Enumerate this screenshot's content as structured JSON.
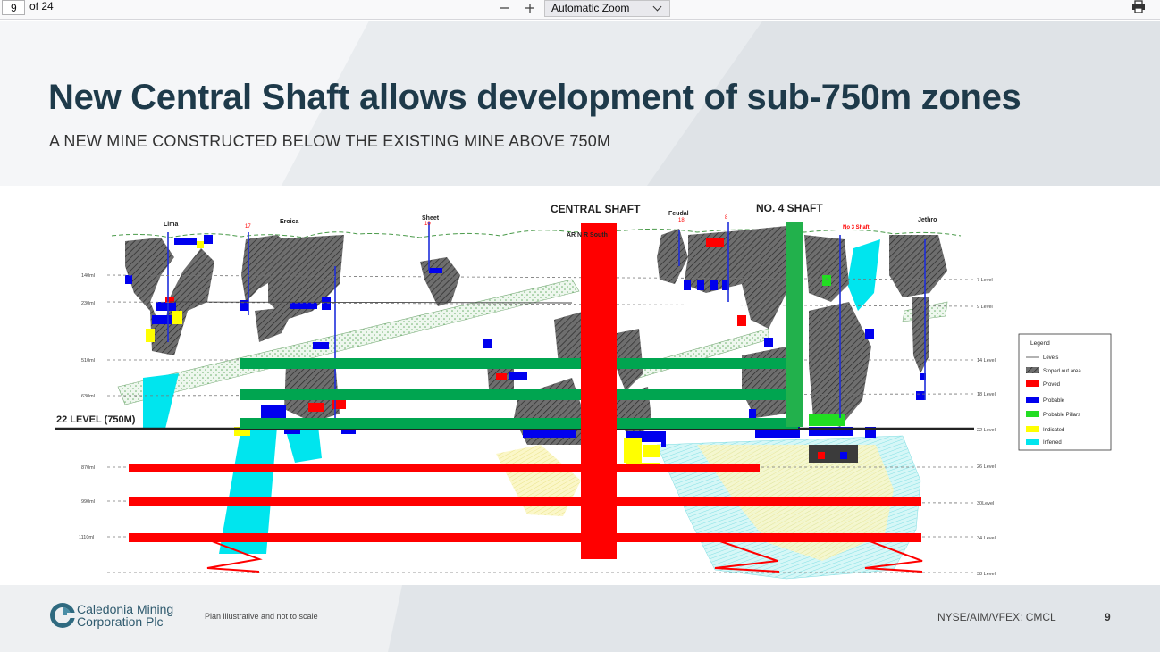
{
  "toolbar": {
    "page_number": "9",
    "page_count": "of 24",
    "zoom_label": "Automatic Zoom"
  },
  "slide": {
    "title": "New Central Shaft allows development of sub-750m zones",
    "subtitle": "A NEW MINE CONSTRUCTED BELOW THE EXISTING MINE ABOVE 750M"
  },
  "diagram": {
    "central_shaft_label": "CENTRAL SHAFT",
    "no4_shaft_label": "NO. 4 SHAFT",
    "level_22_label": "22 LEVEL (750M)",
    "sublabel": "AR N      R South",
    "no3_shaft_label": "No 3 Shaft",
    "ore_bodies": [
      "Lima",
      "Eroica",
      "Sheet",
      "Feudal",
      "Jethro"
    ],
    "ore_body_numbers": [
      "17",
      "10",
      "18",
      "8"
    ],
    "depth_labels": [
      "140ml",
      "230ml",
      "510ml",
      "630ml",
      "870ml",
      "990ml",
      "1110ml"
    ],
    "level_labels": [
      "7 Level",
      "9 Level",
      "14 Level",
      "18 Level",
      "22 Level",
      "26 Level",
      "30Level",
      "34 Level",
      "38 Level"
    ],
    "legend_title": "Legend",
    "legend": [
      {
        "label": "Levels",
        "color": "#666666"
      },
      {
        "label": "Stoped out area",
        "color": "#777777"
      },
      {
        "label": "Proved",
        "color": "#ff0000"
      },
      {
        "label": "Probable",
        "color": "#0000ee"
      },
      {
        "label": "Probable Pillars",
        "color": "#22dd22"
      },
      {
        "label": "Indicated",
        "color": "#ffff00"
      },
      {
        "label": "Inferred",
        "color": "#00e5ee"
      }
    ],
    "colors": {
      "proposed_development": "#ff0000",
      "existing_development": "#00a550",
      "shaft_central": "#ff0000",
      "shaft_no4": "#22b14c"
    }
  },
  "footer": {
    "company_line1": "Caledonia Mining",
    "company_line2": "Corporation Plc",
    "note": "Plan illustrative and not to scale",
    "ticker": "NYSE/AIM/VFEX: CMCL",
    "page": "9"
  }
}
